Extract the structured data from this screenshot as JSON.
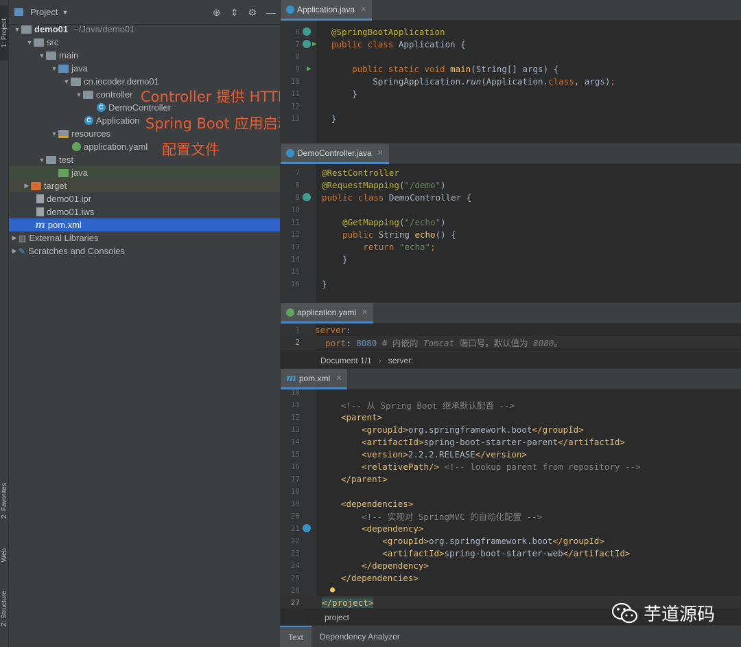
{
  "toolstrip": {
    "project_tab": "1: Project",
    "favorites_tab": "2: Favorites",
    "web_tab": "Web",
    "structure_tab": "Z: Structure"
  },
  "project_panel": {
    "title": "Project",
    "tree": [
      {
        "label": "demo01",
        "secondary": "~/Java/demo01"
      },
      {
        "label": "src"
      },
      {
        "label": "main"
      },
      {
        "label": "java"
      },
      {
        "label": "cn.iocoder.demo01"
      },
      {
        "label": "controller"
      },
      {
        "label": "DemoController"
      },
      {
        "label": "Application"
      },
      {
        "label": "resources"
      },
      {
        "label": "application.yaml"
      },
      {
        "label": "test"
      },
      {
        "label": "java"
      },
      {
        "label": "target"
      },
      {
        "label": "demo01.ipr"
      },
      {
        "label": "demo01.iws"
      },
      {
        "label": "pom.xml"
      },
      {
        "label": "External Libraries"
      },
      {
        "label": "Scratches and Consoles"
      }
    ]
  },
  "annotations": {
    "controller": "Controller 提供 HTTP API",
    "application": "Spring Boot 应用启动类，通过它进行运行",
    "config": "配置文件"
  },
  "editors": {
    "application": {
      "tab": "Application.java",
      "line_numbers": [
        "6",
        "7",
        "8",
        "9",
        "10",
        "11",
        "12",
        "13"
      ]
    },
    "democontroller": {
      "tab": "DemoController.java",
      "line_numbers": [
        "7",
        "8",
        "9",
        "10",
        "11",
        "12",
        "13",
        "14",
        "15",
        "16"
      ]
    },
    "yaml": {
      "tab": "application.yaml",
      "line_numbers": [
        "1",
        "2"
      ],
      "breadcrumb_doc": "Document 1/1",
      "breadcrumb_sep": "›",
      "breadcrumb_key": "server:"
    },
    "pom": {
      "tab": "pom.xml",
      "line_numbers": [
        "10",
        "11",
        "12",
        "13",
        "14",
        "15",
        "16",
        "17",
        "18",
        "19",
        "20",
        "21",
        "22",
        "23",
        "24",
        "25",
        "26",
        "27"
      ],
      "breadcrumb": "project"
    }
  },
  "bottom_tabs": [
    "Text",
    "Dependency Analyzer"
  ],
  "watermark": "芋道源码",
  "colors": {
    "background": "#2b2b2b",
    "panel": "#3c3f41",
    "selection": "#2f65ca",
    "annotation": "#ed5b2f",
    "keyword": "#cc7832",
    "annotation_code": "#bbb529",
    "string": "#6a8759"
  }
}
